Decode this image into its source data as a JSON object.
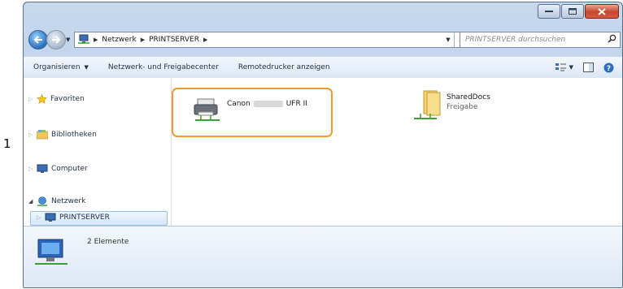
{
  "callout": {
    "number": "1"
  },
  "address": {
    "crumbs": [
      "Netzwerk",
      "PRINTSERVER"
    ]
  },
  "search": {
    "placeholder": "PRINTSERVER durchsuchen"
  },
  "toolbar": {
    "organize": "Organisieren",
    "network_center": "Netzwerk- und Freigabecenter",
    "remote_printers": "Remotedrucker anzeigen"
  },
  "navpane": {
    "favorites": "Favoriten",
    "libraries": "Bibliotheken",
    "computer": "Computer",
    "network": "Netzwerk",
    "printserver": "PRINTSERVER"
  },
  "items": {
    "printer": {
      "name_prefix": "Canon",
      "name_suffix": "UFR II"
    },
    "share": {
      "name": "SharedDocs",
      "sub": "Freigabe"
    }
  },
  "details": {
    "count": "2 Elemente"
  },
  "colors": {
    "highlight": "#f29a2e",
    "close_button": "#c8442c"
  }
}
